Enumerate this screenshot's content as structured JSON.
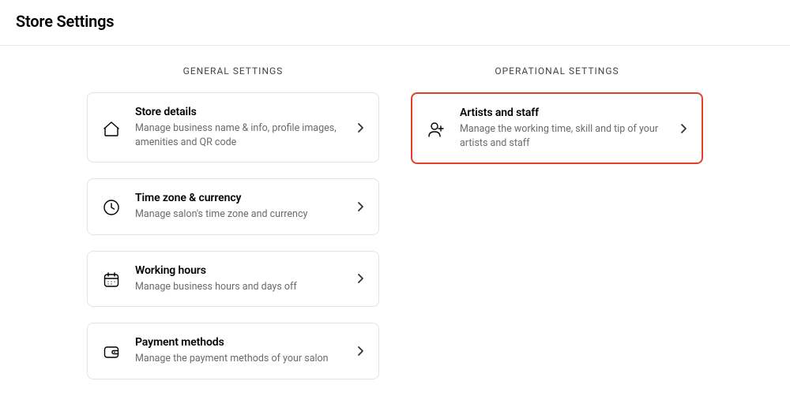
{
  "page_title": "Store Settings",
  "sections": {
    "general": {
      "heading": "GENERAL SETTINGS",
      "items": [
        {
          "title": "Store details",
          "desc": "Manage business name & info, profile images, amenities and QR code"
        },
        {
          "title": "Time zone & currency",
          "desc": "Manage salon's time zone and currency"
        },
        {
          "title": "Working hours",
          "desc": "Manage business hours and days off"
        },
        {
          "title": "Payment methods",
          "desc": "Manage the payment methods of your salon"
        }
      ]
    },
    "operational": {
      "heading": "OPERATIONAL SETTINGS",
      "items": [
        {
          "title": "Artists and staff",
          "desc": "Manage the working time, skill and tip of your artists and staff"
        }
      ]
    }
  }
}
